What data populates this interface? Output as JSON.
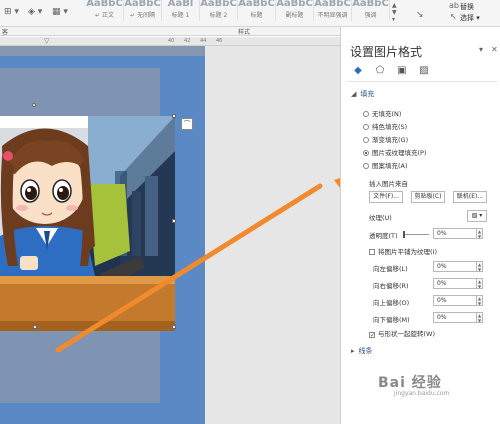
{
  "ribbon": {
    "styles": [
      {
        "preview": "AaBbC",
        "name": "↵ 正文"
      },
      {
        "preview": "AaBbC",
        "name": "↵ 无间隔"
      },
      {
        "preview": "AaBl",
        "name": "标题 1"
      },
      {
        "preview": "AaBbC",
        "name": "标题 2"
      },
      {
        "preview": "AaBbC",
        "name": "标题"
      },
      {
        "preview": "AaBbC",
        "name": "副标题"
      },
      {
        "preview": "AaBbC",
        "name": "不明显强调"
      },
      {
        "preview": "AaBbC",
        "name": "强调"
      }
    ],
    "edit_replace": "替换",
    "edit_select": "选择 ▾",
    "group_font_fragment": "客",
    "group_styles": "样式"
  },
  "ruler": {
    "ticks": [
      "40",
      "42",
      "44",
      "46"
    ]
  },
  "panel": {
    "title": "设置图片格式",
    "section_fill": "填充",
    "fill_options": [
      {
        "label": "无填充(N)",
        "selected": false
      },
      {
        "label": "纯色填充(S)",
        "selected": false
      },
      {
        "label": "渐变填充(G)",
        "selected": false
      },
      {
        "label": "图片或纹理填充(P)",
        "selected": true
      },
      {
        "label": "图案填充(A)",
        "selected": false
      }
    ],
    "insert_from_label": "插入图片来自",
    "btn_file": "文件(F)...",
    "btn_clipboard": "剪贴板(C)",
    "btn_online": "联机(E)...",
    "texture_label": "纹理(U)",
    "transparency_label": "透明度(T)",
    "transparency_value": "0%",
    "tile_label": "将图片平铺为纹理(I)",
    "offsets": [
      {
        "label": "向左偏移(L)",
        "value": "0%"
      },
      {
        "label": "向右偏移(R)",
        "value": "0%"
      },
      {
        "label": "向上偏移(O)",
        "value": "0%"
      },
      {
        "label": "向下偏移(M)",
        "value": "0%"
      }
    ],
    "rotate_label": "与形状一起旋转(W)",
    "section_line": "线条"
  },
  "watermark": {
    "text": "Bai 经验",
    "sub": "jingyan.baidu.com"
  },
  "colors": {
    "arrow": "#f08a2c",
    "page_blue": "#5a89c6",
    "doc_bg": "#8496b0",
    "panel_accent": "#2e6bb8"
  }
}
